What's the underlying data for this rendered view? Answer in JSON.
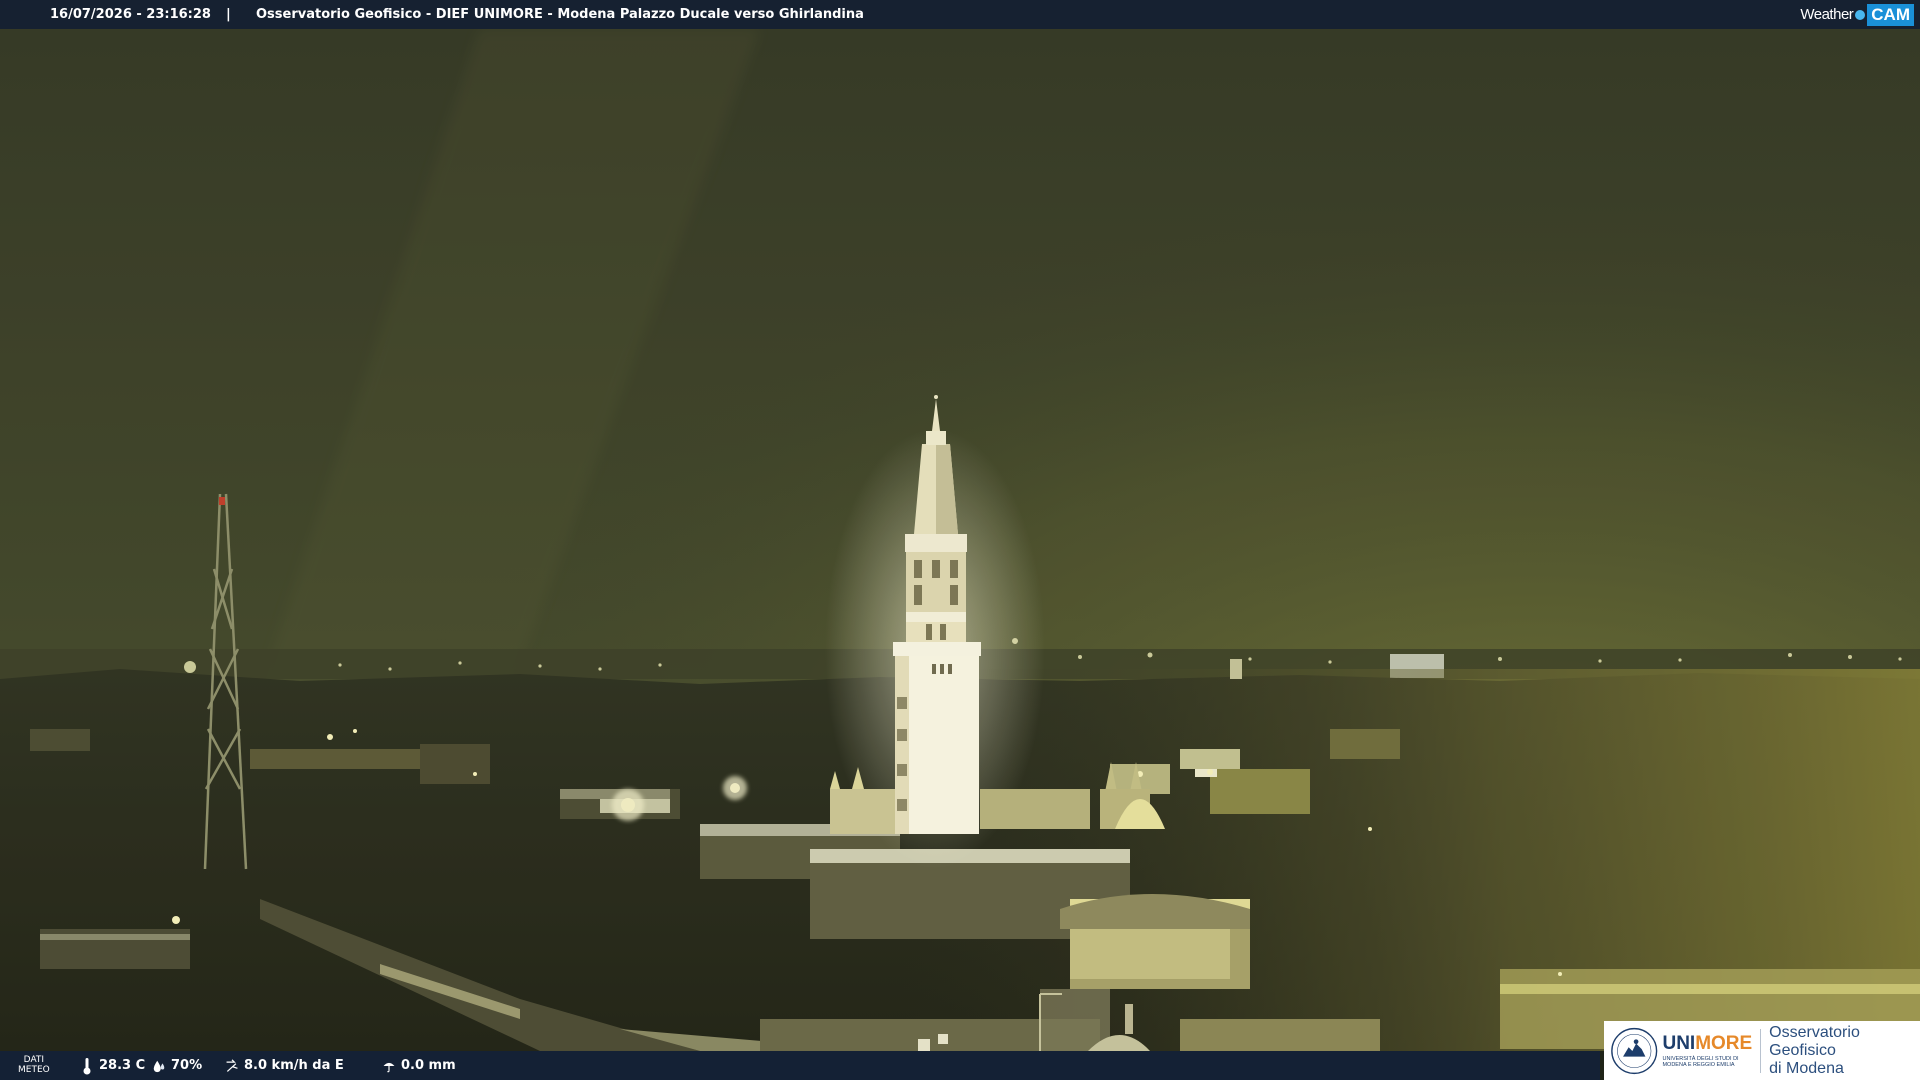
{
  "top_bar": {
    "timestamp": "16/07/2026 - 23:16:28",
    "separator": "|",
    "title": "Osservatorio Geofisico - DIEF UNIMORE - Modena Palazzo Ducale verso Ghirlandina",
    "brand_weather": "Weather",
    "brand_cam": "CAM"
  },
  "scene": {
    "icon": "webcam-night-view",
    "colors": {
      "sky": "#3e4228",
      "sky_glow": "#6a6f36",
      "city": "#2a2c1a",
      "lights": "#f7f2b0"
    }
  },
  "bottom_bar": {
    "dati_label_line1": "DATI",
    "dati_label_line2": "METEO",
    "temperature": "28.3 C",
    "humidity": "70%",
    "wind": "8.0 km/h da E",
    "rain": "0.0 mm",
    "icons": [
      "thermometer-icon",
      "humidity-drop-icon",
      "wind-icon",
      "rain-umbrella-icon"
    ]
  },
  "logo": {
    "uni_name_part1": "UNI",
    "uni_name_part2": "MORE",
    "uni_subtitle_line1": "UNIVERSITÀ DEGLI STUDI DI",
    "uni_subtitle_line2": "MODENA E REGGIO EMILIA",
    "org_line1": "Osservatorio Geofisico",
    "org_line2": "di Modena"
  }
}
